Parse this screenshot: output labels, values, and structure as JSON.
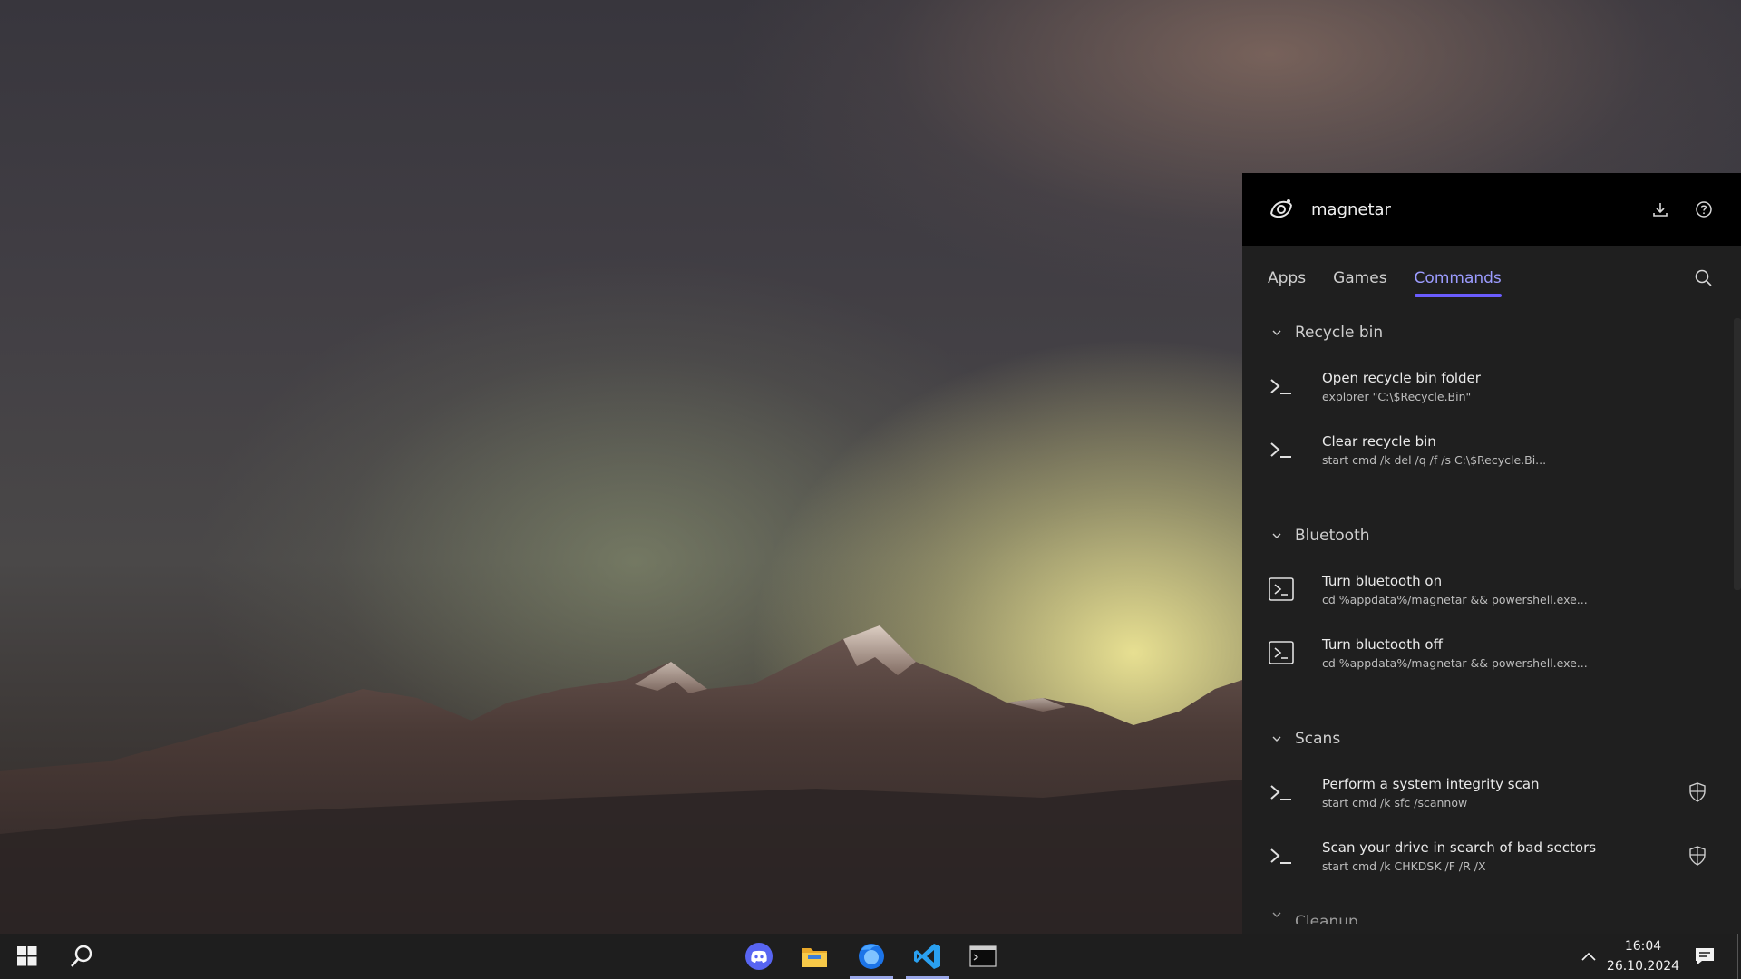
{
  "panel": {
    "app_name": "magnetar",
    "header_icons": [
      "download-icon",
      "help-icon"
    ],
    "tabs": [
      {
        "label": "Apps",
        "active": false
      },
      {
        "label": "Games",
        "active": false
      },
      {
        "label": "Commands",
        "active": true
      }
    ],
    "accent_color": "#6a5cff",
    "groups": [
      {
        "name": "Recycle bin",
        "items": [
          {
            "title": "Open recycle bin folder",
            "command": "explorer \"C:\\$Recycle.Bin\"",
            "icon": "cmd-prompt-icon"
          },
          {
            "title": "Clear recycle bin",
            "command": "start cmd /k del /q /f /s C:\\$Recycle.Bi...",
            "icon": "cmd-prompt-icon"
          }
        ]
      },
      {
        "name": "Bluetooth",
        "items": [
          {
            "title": "Turn bluetooth on",
            "command": "cd %appdata%/magnetar && powershell.exe...",
            "icon": "powershell-icon"
          },
          {
            "title": "Turn bluetooth off",
            "command": "cd %appdata%/magnetar && powershell.exe...",
            "icon": "powershell-icon"
          }
        ]
      },
      {
        "name": "Scans",
        "items": [
          {
            "title": "Perform a system integrity scan",
            "command": "start cmd /k sfc /scannow",
            "icon": "cmd-prompt-icon",
            "admin": true
          },
          {
            "title": "Scan your drive in search of bad sectors",
            "command": "start cmd /k CHKDSK /F /R /X",
            "icon": "cmd-prompt-icon",
            "admin": true
          }
        ]
      },
      {
        "name": "Cleanup",
        "items": []
      }
    ]
  },
  "taskbar": {
    "pinned": [
      "discord-icon",
      "file-explorer-icon",
      "firefox-icon",
      "vscode-icon",
      "terminal-icon"
    ],
    "time": "16:04",
    "date": "26.10.2024"
  }
}
